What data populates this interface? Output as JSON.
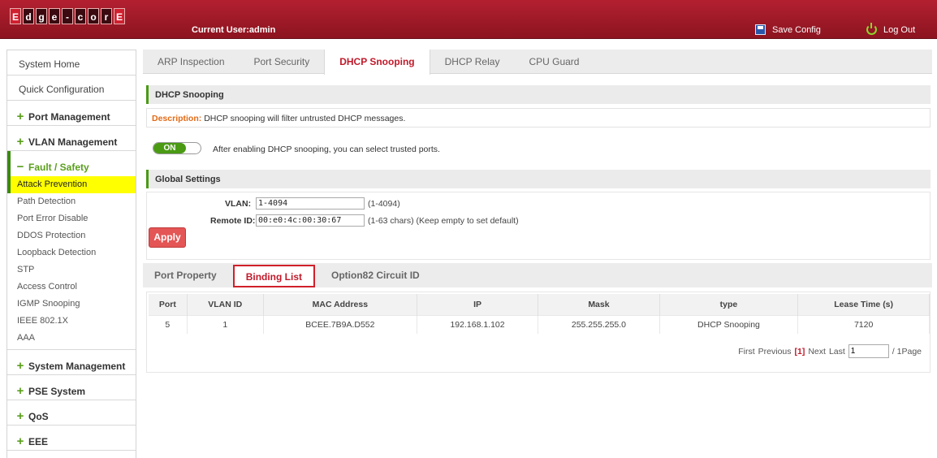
{
  "header": {
    "logo_letters": [
      "E",
      "d",
      "g",
      "e",
      "-",
      "c",
      "o",
      "r",
      "E"
    ],
    "current_user": "Current User:admin",
    "save_label": "Save Config",
    "logout_label": "Log Out"
  },
  "sidebar": {
    "top_items": [
      "System Home",
      "Quick Configuration"
    ],
    "groups_before": [
      {
        "sign": "+",
        "label": "Port Management"
      },
      {
        "sign": "+",
        "label": "VLAN Management"
      }
    ],
    "open_group": {
      "sign": "−",
      "label": "Fault / Safety"
    },
    "sub_items": [
      "Attack Prevention",
      "Path Detection",
      "Port Error Disable",
      "DDOS Protection",
      "Loopback Detection",
      "STP",
      "Access Control",
      "IGMP Snooping",
      "IEEE 802.1X",
      "AAA"
    ],
    "active_sub": "Attack Prevention",
    "groups_after": [
      {
        "sign": "+",
        "label": "System Management"
      },
      {
        "sign": "+",
        "label": "PSE System"
      },
      {
        "sign": "+",
        "label": "QoS"
      },
      {
        "sign": "+",
        "label": "EEE"
      }
    ]
  },
  "tabs": [
    "ARP Inspection",
    "Port Security",
    "DHCP Snooping",
    "DHCP Relay",
    "CPU Guard"
  ],
  "active_tab": "DHCP Snooping",
  "section1": {
    "title": "DHCP Snooping",
    "desc_key": "Description:",
    "desc_text": "DHCP snooping will filter untrusted DHCP messages.",
    "toggle_label": "ON",
    "toggle_text": "After enabling DHCP snooping, you can select trusted ports."
  },
  "global": {
    "title": "Global Settings",
    "vlan_label": "VLAN:",
    "vlan_value": "1-4094",
    "vlan_hint": "(1-4094)",
    "remote_label": "Remote ID:",
    "remote_value": "00:e0:4c:00:30:67",
    "remote_hint": "(1-63 chars) (Keep empty to set default)",
    "apply_label": "Apply"
  },
  "subtabs": [
    "Port Property",
    "Binding List",
    "Option82 Circuit ID"
  ],
  "active_subtab": "Binding List",
  "table": {
    "headers": [
      "Port",
      "VLAN ID",
      "MAC Address",
      "IP",
      "Mask",
      "type",
      "Lease Time (s)"
    ],
    "rows": [
      [
        "5",
        "1",
        "BCEE.7B9A.D552",
        "192.168.1.102",
        "255.255.255.0",
        "DHCP Snooping",
        "7120"
      ]
    ]
  },
  "pager": {
    "first": "First",
    "previous": "Previous",
    "current": "[1]",
    "next": "Next",
    "last": "Last",
    "page_value": "1",
    "total": "/ 1Page"
  },
  "colors": {
    "brand_red": "#b32030",
    "accent_green": "#4a9a14",
    "highlight": "#ffff00"
  }
}
